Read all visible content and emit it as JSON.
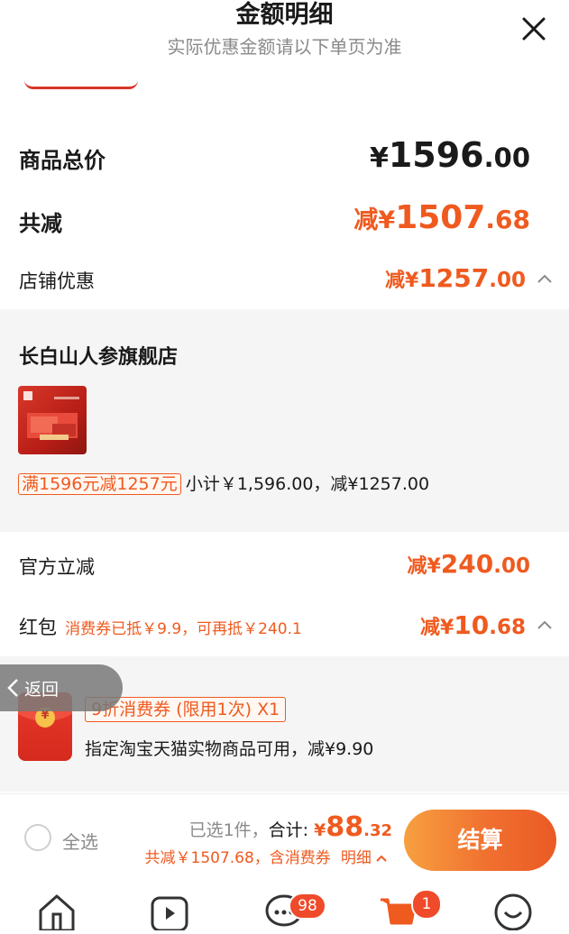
{
  "header": {
    "title": "金额明细",
    "subtitle": "实际优惠金额请以下单页为准"
  },
  "summary": {
    "total_label": "商品总价",
    "total_currency": "¥",
    "total_int": "1596",
    "total_dec": ".00",
    "reduce_label": "共减",
    "reduce_prefix": "减¥",
    "reduce_int": "1507",
    "reduce_dec": ".68"
  },
  "store_discount": {
    "label": "店铺优惠",
    "prefix": "减¥",
    "int": "1257",
    "dec": ".00",
    "store_name": "长白山人参旗舰店",
    "promo_tag": "满1596元减1257元",
    "subtotal_text": "小计￥1,596.00，减¥1257.00"
  },
  "official": {
    "label": "官方立减",
    "prefix": "减¥",
    "int": "240",
    "dec": ".00"
  },
  "redpacket": {
    "label": "红包",
    "note": "消费券已抵￥9.9，可再抵￥240.1",
    "prefix": "减¥",
    "int": "10",
    "dec": ".68",
    "coupon_tag": "9折消费券 (限用1次) X1",
    "coupon_desc": "指定淘宝天猫实物商品可用，减¥9.90",
    "packet_symbol": "¥"
  },
  "back": {
    "label": "返回"
  },
  "bottom": {
    "select_all": "全选",
    "selected_count": "已选1件，",
    "total_label": "合计: ",
    "total_currency": "¥",
    "total_int": "88",
    "total_dec": ".32",
    "reduce_note": "共减￥1507.68，含消费券",
    "detail_link": "明细",
    "checkout": "结算"
  },
  "tabbar": {
    "messages_badge": "98",
    "cart_badge": "1"
  },
  "colors": {
    "accent": "#ef5a1f",
    "checkout_start": "#f7a040",
    "checkout_end": "#ea5a24",
    "panel_bg": "#f5f5f5"
  }
}
